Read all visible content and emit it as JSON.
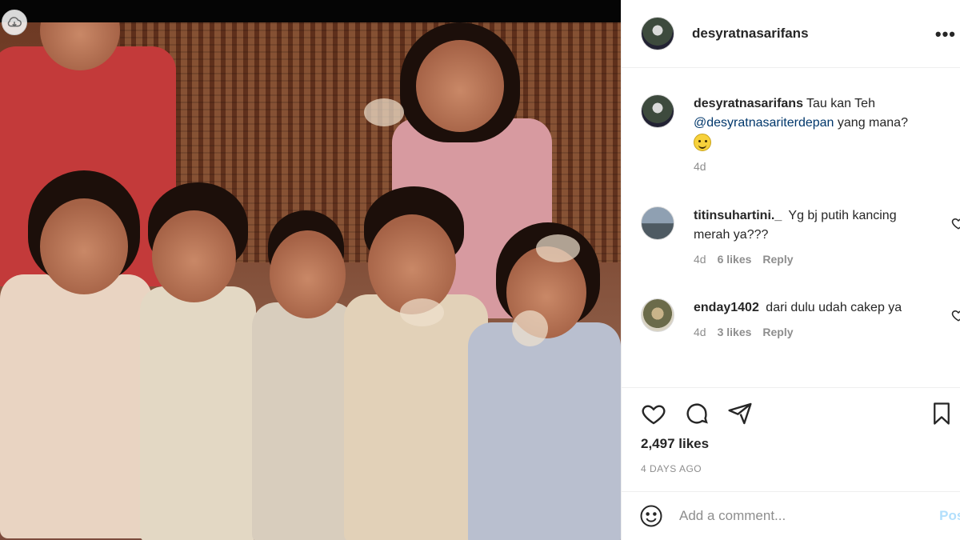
{
  "post": {
    "username": "desyratnasarifans",
    "more_label": "•••"
  },
  "caption": {
    "username": "desyratnasarifans",
    "text_before": "Tau kan Teh",
    "mention": "@desyratnasariterdepan",
    "text_after": "yang mana?",
    "emoji": "smiling-face-emoji",
    "time": "4d"
  },
  "comments": [
    {
      "username": "titinsuhartini._",
      "text": "Yg bj putih kancing merah ya???",
      "time": "4d",
      "likes": "6 likes",
      "reply": "Reply"
    },
    {
      "username": "enday1402",
      "text": "dari dulu udah cakep ya",
      "time": "4d",
      "likes": "3 likes",
      "reply": "Reply"
    }
  ],
  "actions": {
    "likes_count": "2,497 likes",
    "time_ago": "4 DAYS AGO"
  },
  "add_comment": {
    "placeholder": "Add a comment...",
    "post_label": "Post"
  },
  "icons": [
    "heart-icon",
    "comment-icon",
    "share-icon",
    "bookmark-icon",
    "smile-icon",
    "more-icon"
  ]
}
